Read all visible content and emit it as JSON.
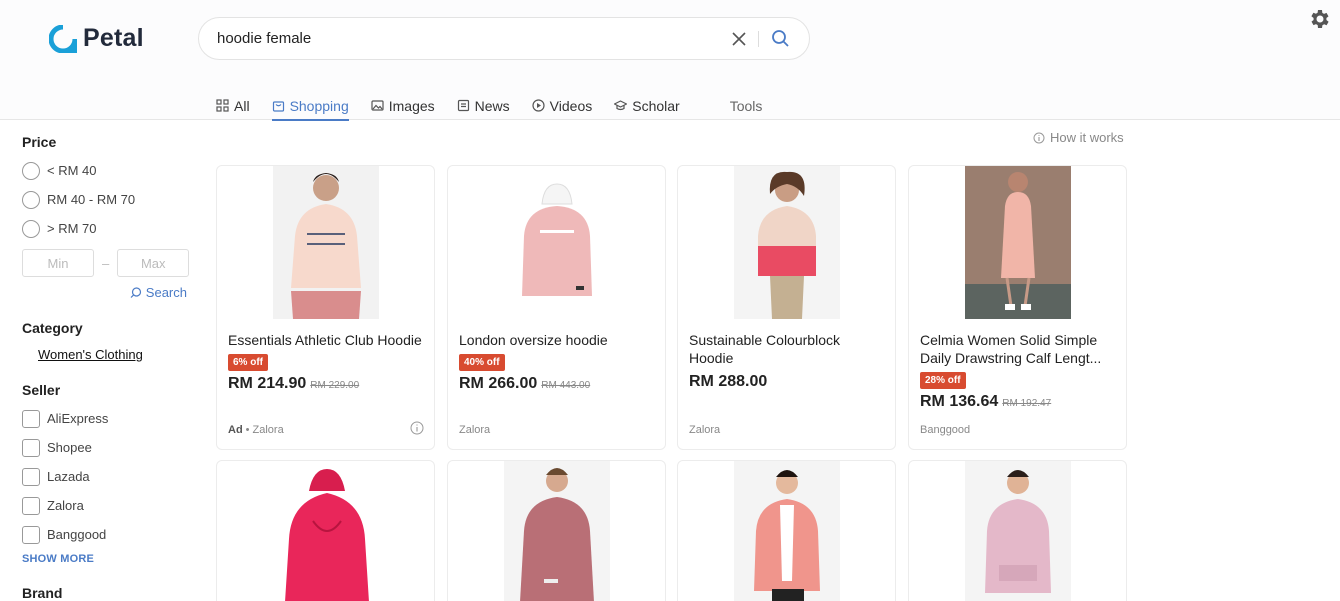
{
  "brand": {
    "name": "Petal",
    "color": "#1aa0d8"
  },
  "search": {
    "query": "hoodie female"
  },
  "tabs": [
    {
      "label": "All",
      "icon": "grid-icon"
    },
    {
      "label": "Shopping",
      "icon": "bag-icon",
      "active": true
    },
    {
      "label": "Images",
      "icon": "image-icon"
    },
    {
      "label": "News",
      "icon": "news-icon"
    },
    {
      "label": "Videos",
      "icon": "play-icon"
    },
    {
      "label": "Scholar",
      "icon": "graduation-cap-icon"
    },
    {
      "label": "Tools"
    }
  ],
  "how_it_works": "How it works",
  "filters": {
    "price": {
      "title": "Price",
      "options": [
        "< RM 40",
        "RM 40 - RM 70",
        "> RM 70"
      ],
      "min_placeholder": "Min",
      "max_placeholder": "Max",
      "dash": "–",
      "search_label": "Search"
    },
    "category": {
      "title": "Category",
      "selected": "Women's Clothing"
    },
    "seller": {
      "title": "Seller",
      "options": [
        "AliExpress",
        "Shopee",
        "Lazada",
        "Zalora",
        "Banggood"
      ],
      "show_more": "SHOW MORE"
    },
    "brand": {
      "title": "Brand"
    }
  },
  "products": [
    {
      "title": "Essentials Athletic Club Hoodie",
      "badge": "6% off",
      "price": "RM 214.90",
      "old_price": "RM 229.00",
      "ad": "Ad",
      "seller": "Zalora",
      "info": true,
      "hoodie_color": "#f7d9cc",
      "bg": "#f2f2f2"
    },
    {
      "title": "London oversize hoodie",
      "badge": "40% off",
      "price": "RM 266.00",
      "old_price": "RM 443.00",
      "ad": "",
      "seller": "Zalora",
      "hoodie_color": "#efb9b9",
      "bg": "#ffffff"
    },
    {
      "title": "Sustainable Colourblock Hoodie",
      "badge": "",
      "price": "RM 288.00",
      "old_price": "",
      "ad": "",
      "seller": "Zalora",
      "hoodie_color": "#e94b63",
      "bg": "#f4f4f4"
    },
    {
      "title": "Celmia Women Solid Simple Daily Drawstring Calf Lengt...",
      "badge": "28% off",
      "price": "RM 136.64",
      "old_price": "RM 192.47",
      "ad": "",
      "seller": "Banggood",
      "hoodie_color": "#f1b5a8",
      "bg": "#9a7e6f"
    },
    {
      "title": "",
      "hoodie_color": "#e9265a",
      "bg": "#ffffff"
    },
    {
      "title": "",
      "hoodie_color": "#b96f76",
      "bg": "#f4f4f4"
    },
    {
      "title": "",
      "hoodie_color": "#f0958c",
      "bg": "#f4f4f4"
    },
    {
      "title": "",
      "hoodie_color": "#e4b8c9",
      "bg": "#f4f4f4"
    }
  ]
}
